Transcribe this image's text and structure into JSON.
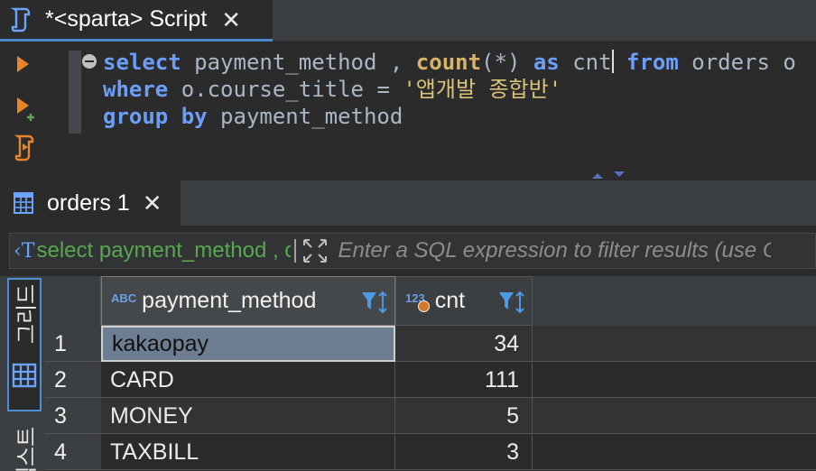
{
  "editor_tab": {
    "title": "*<sparta> Script",
    "close": "✕"
  },
  "editor": {
    "lines": [
      [
        {
          "t": "select",
          "c": "kw"
        },
        {
          "t": " payment_method , ",
          "c": "id"
        },
        {
          "t": "count",
          "c": "fn"
        },
        {
          "t": "(*) ",
          "c": "id"
        },
        {
          "t": "as",
          "c": "kw"
        },
        {
          "t": " cnt",
          "c": "id"
        },
        {
          "t": "|",
          "c": "cursor"
        },
        {
          "t": " ",
          "c": "id"
        },
        {
          "t": "from",
          "c": "kw"
        },
        {
          "t": " orders o",
          "c": "id"
        }
      ],
      [
        {
          "t": "where",
          "c": "kw"
        },
        {
          "t": " o.course_title = ",
          "c": "id"
        },
        {
          "t": "'앱개발 종합반'",
          "c": "str"
        }
      ],
      [
        {
          "t": "group by",
          "c": "kw"
        },
        {
          "t": " payment_method",
          "c": "id"
        }
      ]
    ]
  },
  "results_tab": {
    "title": "orders 1",
    "close": "✕"
  },
  "filter": {
    "sql_icon": "‹T",
    "query_text": "select payment_method , count(*) as cnt from orders o",
    "placeholder": "Enter a SQL expression to filter results (use Ctrl+Space)"
  },
  "side_tabs": {
    "grid_label": "그리드",
    "text_label": "텍스트"
  },
  "table": {
    "columns": [
      {
        "type": "ABC",
        "name": "payment_method"
      },
      {
        "type": "123",
        "name": "cnt"
      }
    ],
    "rows": [
      {
        "num": "1",
        "payment_method": "kakaopay",
        "cnt": "34"
      },
      {
        "num": "2",
        "payment_method": "CARD",
        "cnt": "111"
      },
      {
        "num": "3",
        "payment_method": "MONEY",
        "cnt": "5"
      },
      {
        "num": "4",
        "payment_method": "TAXBILL",
        "cnt": "3"
      }
    ]
  },
  "colors": {
    "accent": "#4a88c7",
    "keyword": "#6c9ef8",
    "function": "#d7b36a",
    "string": "#d8c27a",
    "filter_query": "#59a84f",
    "selection": "#6e7e92"
  },
  "icons": {
    "editor_tab": "script-file-icon",
    "run": "run-statement-icon",
    "run_new_tab": "run-new-tab-icon",
    "explain": "execute-script-icon",
    "results_tab": "table-grid-icon",
    "filter_expand": "expand-arrows-icon",
    "sort": "filter-sort-icon",
    "grid_view": "grid-view-icon"
  }
}
